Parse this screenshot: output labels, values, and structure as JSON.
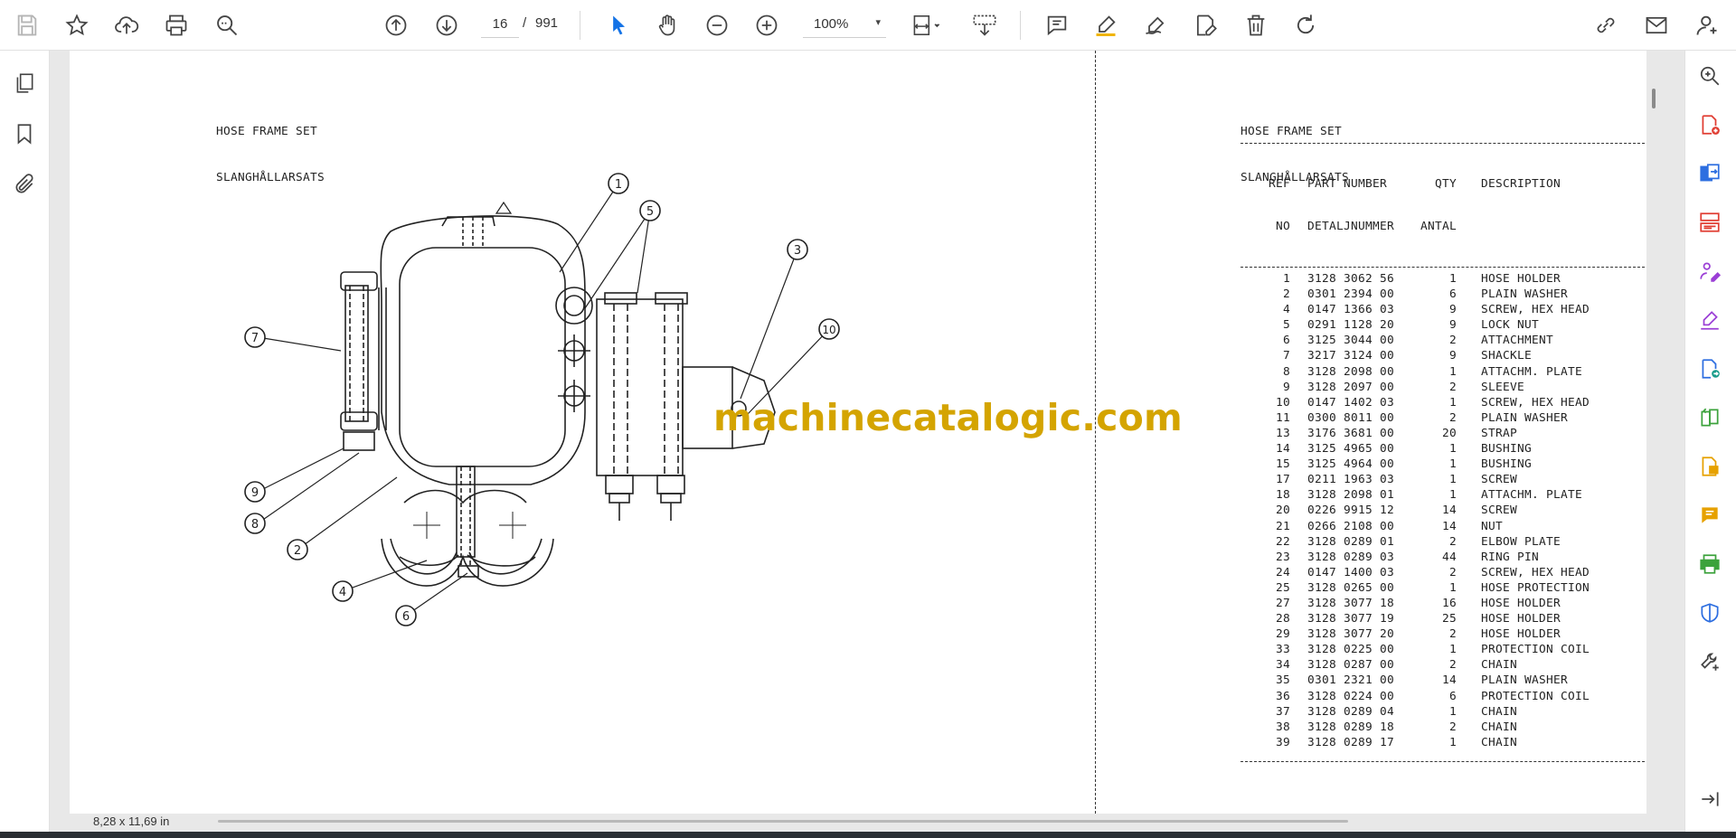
{
  "toolbar": {
    "page_current": "16",
    "page_separator": "/",
    "page_total": "991",
    "zoom": "100%",
    "zoom_caret": "▾",
    "accent": "#1473e6"
  },
  "viewer": {
    "page_size": "8,28 x 11,69 in",
    "collapse_left": "◂",
    "collapse_right": "◂"
  },
  "document": {
    "title_left_line1": "HOSE FRAME SET",
    "title_left_line2": "SLANGHÅLLARSATS",
    "title_right_line1": "HOSE FRAME SET",
    "title_right_line2": "SLANGHÅLLARSATS",
    "watermark": "machinecatalogic.com",
    "callouts": [
      "1",
      "5",
      "3",
      "10",
      "7",
      "9",
      "8",
      "2",
      "4",
      "6"
    ],
    "parts_header": {
      "ref": "REF",
      "no": "NO",
      "part_number": "PART NUMBER",
      "detaljnummer": "DETALJNUMMER",
      "qty": "QTY",
      "antal": "ANTAL",
      "description": "DESCRIPTION"
    },
    "parts": [
      {
        "ref": "1",
        "pn": "3128 3062 56",
        "qty": "1",
        "desc": "HOSE HOLDER"
      },
      {
        "ref": "2",
        "pn": "0301 2394 00",
        "qty": "6",
        "desc": "PLAIN WASHER"
      },
      {
        "ref": "4",
        "pn": "0147 1366 03",
        "qty": "9",
        "desc": "SCREW, HEX HEAD"
      },
      {
        "ref": "5",
        "pn": "0291 1128 20",
        "qty": "9",
        "desc": "LOCK NUT"
      },
      {
        "ref": "6",
        "pn": "3125 3044 00",
        "qty": "2",
        "desc": "ATTACHMENT"
      },
      {
        "ref": "7",
        "pn": "3217 3124 00",
        "qty": "9",
        "desc": "SHACKLE"
      },
      {
        "ref": "8",
        "pn": "3128 2098 00",
        "qty": "1",
        "desc": "ATTACHM. PLATE"
      },
      {
        "ref": "9",
        "pn": "3128 2097 00",
        "qty": "2",
        "desc": "SLEEVE"
      },
      {
        "ref": "10",
        "pn": "0147 1402 03",
        "qty": "1",
        "desc": "SCREW, HEX HEAD"
      },
      {
        "ref": "11",
        "pn": "0300 8011 00",
        "qty": "2",
        "desc": "PLAIN WASHER"
      },
      {
        "ref": "13",
        "pn": "3176 3681 00",
        "qty": "20",
        "desc": "STRAP"
      },
      {
        "ref": "14",
        "pn": "3125 4965 00",
        "qty": "1",
        "desc": "BUSHING"
      },
      {
        "ref": "15",
        "pn": "3125 4964 00",
        "qty": "1",
        "desc": "BUSHING"
      },
      {
        "ref": "17",
        "pn": "0211 1963 03",
        "qty": "1",
        "desc": "SCREW"
      },
      {
        "ref": "18",
        "pn": "3128 2098 01",
        "qty": "1",
        "desc": "ATTACHM. PLATE"
      },
      {
        "ref": "20",
        "pn": "0226 9915 12",
        "qty": "14",
        "desc": "SCREW"
      },
      {
        "ref": "21",
        "pn": "0266 2108 00",
        "qty": "14",
        "desc": "NUT"
      },
      {
        "ref": "22",
        "pn": "3128 0289 01",
        "qty": "2",
        "desc": "ELBOW PLATE"
      },
      {
        "ref": "23",
        "pn": "3128 0289 03",
        "qty": "44",
        "desc": "RING PIN"
      },
      {
        "ref": "24",
        "pn": "0147 1400 03",
        "qty": "2",
        "desc": "SCREW, HEX HEAD"
      },
      {
        "ref": "25",
        "pn": "3128 0265 00",
        "qty": "1",
        "desc": "HOSE PROTECTION"
      },
      {
        "ref": "27",
        "pn": "3128 3077 18",
        "qty": "16",
        "desc": "HOSE HOLDER"
      },
      {
        "ref": "28",
        "pn": "3128 3077 19",
        "qty": "25",
        "desc": "HOSE HOLDER"
      },
      {
        "ref": "29",
        "pn": "3128 3077 20",
        "qty": "2",
        "desc": "HOSE HOLDER"
      },
      {
        "ref": "33",
        "pn": "3128 0225 00",
        "qty": "1",
        "desc": "PROTECTION COIL"
      },
      {
        "ref": "34",
        "pn": "3128 0287 00",
        "qty": "2",
        "desc": "CHAIN"
      },
      {
        "ref": "35",
        "pn": "0301 2321 00",
        "qty": "14",
        "desc": "PLAIN WASHER"
      },
      {
        "ref": "36",
        "pn": "3128 0224 00",
        "qty": "6",
        "desc": "PROTECTION COIL"
      },
      {
        "ref": "37",
        "pn": "3128 0289 04",
        "qty": "1",
        "desc": "CHAIN"
      },
      {
        "ref": "38",
        "pn": "3128 0289 18",
        "qty": "2",
        "desc": "CHAIN"
      },
      {
        "ref": "39",
        "pn": "3128 0289 17",
        "qty": "1",
        "desc": "CHAIN"
      }
    ]
  }
}
